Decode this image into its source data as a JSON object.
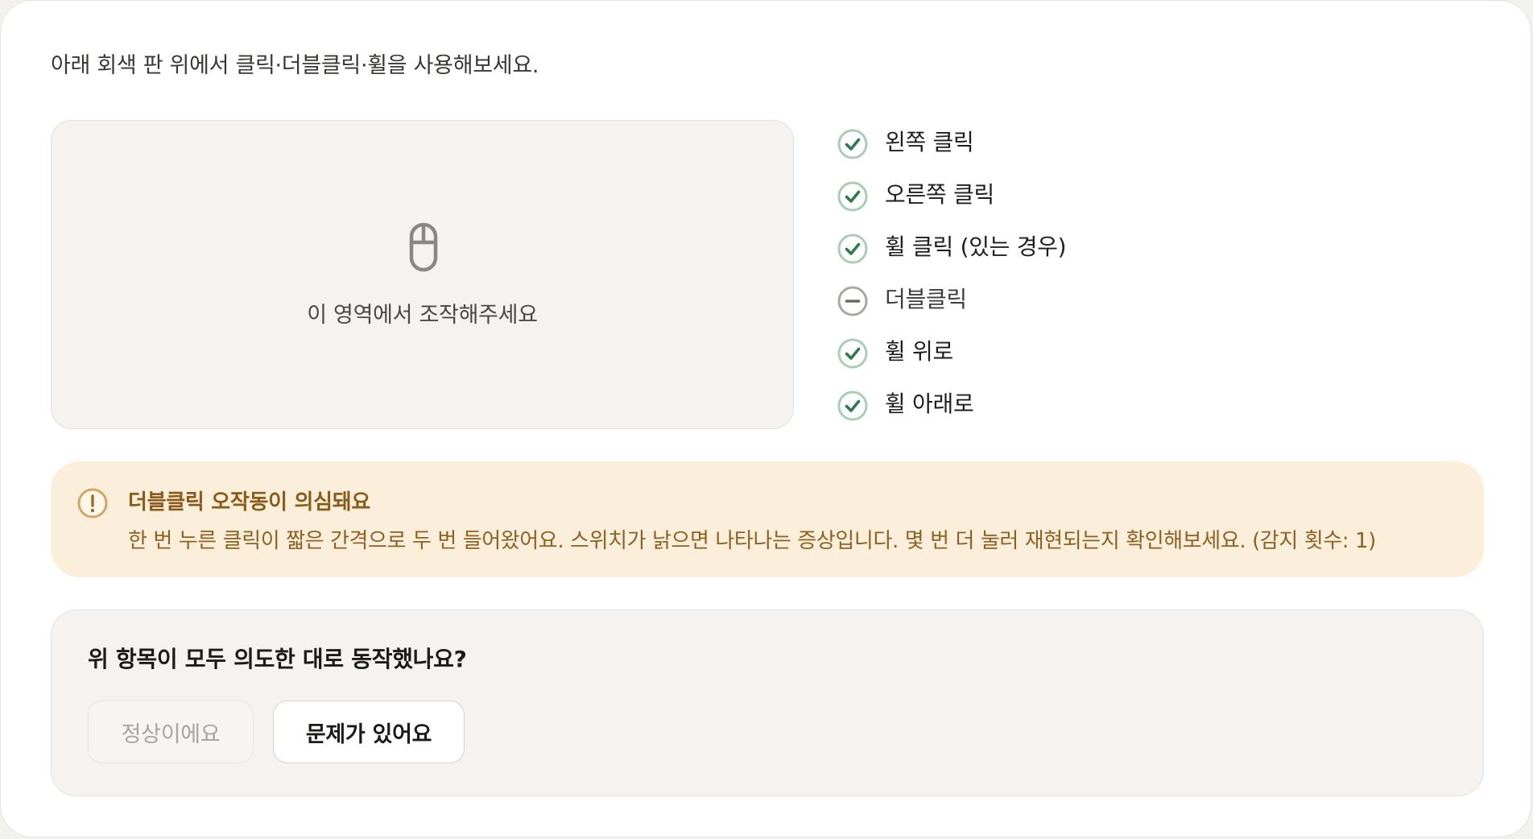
{
  "instruction": "아래 회색 판 위에서 클릭·더블클릭·휠을 사용해보세요.",
  "pad": {
    "icon": "mouse-icon",
    "label": "이 영역에서 조작해주세요"
  },
  "checklist": [
    {
      "label": "왼쪽 클릭",
      "status": "passed",
      "icon": "check-circle-icon"
    },
    {
      "label": "오른쪽 클릭",
      "status": "passed",
      "icon": "check-circle-icon"
    },
    {
      "label": "휠 클릭 (있는 경우)",
      "status": "passed",
      "icon": "check-circle-icon"
    },
    {
      "label": "더블클릭",
      "status": "pending",
      "icon": "minus-circle-icon"
    },
    {
      "label": "휠 위로",
      "status": "passed",
      "icon": "check-circle-icon"
    },
    {
      "label": "휠 아래로",
      "status": "passed",
      "icon": "check-circle-icon"
    }
  ],
  "alert": {
    "icon": "exclamation-circle-icon",
    "title": "더블클릭 오작동이 의심돼요",
    "body": "한 번 누른 클릭이 짧은 간격으로 두 번 들어왔어요. 스위치가 낡으면 나타나는 증상입니다. 몇 번 더 눌러 재현되는지 확인해보세요. (감지 횟수: 1)"
  },
  "question": {
    "text": "위 항목이 모두 의도한 대로 동작했나요?",
    "ok_label": "정상이에요",
    "problem_label": "문제가 있어요"
  },
  "colors": {
    "check_green": "#2e7a4c",
    "check_ring": "#a9cdb6",
    "pending_gray": "#6c6965",
    "alert_bg": "#fbefdc",
    "alert_text": "#8f6020"
  }
}
